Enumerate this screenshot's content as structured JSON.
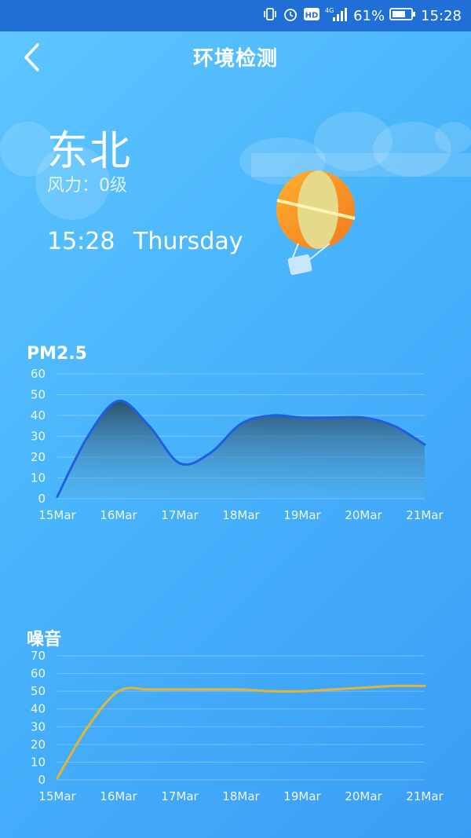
{
  "status_bar": {
    "battery_percent": "61%",
    "time": "15:28",
    "hd_label": "HD",
    "network_label": "4G",
    "icons": [
      "vibrate-icon",
      "alarm-icon",
      "hd-icon",
      "signal-icon",
      "battery-icon"
    ]
  },
  "header": {
    "title": "环境检测",
    "back_icon": "chevron-left-icon"
  },
  "weather": {
    "wind_direction": "东北",
    "wind_power": "风力：0级",
    "time": "15:28",
    "weekday": "Thursday"
  },
  "colors": {
    "status_bar": "#1f6fd6",
    "pm_line": "#1f5fe0",
    "noise_line": "#e1b53a",
    "background_start": "#5fc6ff",
    "background_end": "#3b9df5"
  },
  "chart_data": [
    {
      "type": "area",
      "title": "PM2.5",
      "categories": [
        "15Mar",
        "16Mar",
        "17Mar",
        "18Mar",
        "19Mar",
        "20Mar",
        "21Mar"
      ],
      "x_points": [
        0,
        0.5,
        1,
        1.5,
        2,
        2.5,
        3,
        3.5,
        4,
        4.5,
        5,
        5.5,
        6
      ],
      "values": [
        1,
        30,
        47,
        35,
        17,
        22,
        36,
        40,
        39,
        39,
        39,
        35,
        26
      ],
      "ylim": [
        0,
        60
      ],
      "yticks": [
        0,
        10,
        20,
        30,
        40,
        50,
        60
      ],
      "grid": true
    },
    {
      "type": "line",
      "title": "噪音",
      "categories": [
        "15Mar",
        "16Mar",
        "17Mar",
        "18Mar",
        "19Mar",
        "20Mar",
        "21Mar"
      ],
      "x_points": [
        0,
        0.5,
        1,
        1.5,
        2,
        2.5,
        3,
        3.5,
        4,
        4.5,
        5,
        5.5,
        6
      ],
      "values": [
        1,
        30,
        50,
        51,
        51,
        51,
        51,
        50,
        50,
        51,
        52,
        53,
        53
      ],
      "ylim": [
        0,
        70
      ],
      "yticks": [
        0,
        10,
        20,
        30,
        40,
        50,
        60,
        70
      ],
      "grid": true
    }
  ]
}
